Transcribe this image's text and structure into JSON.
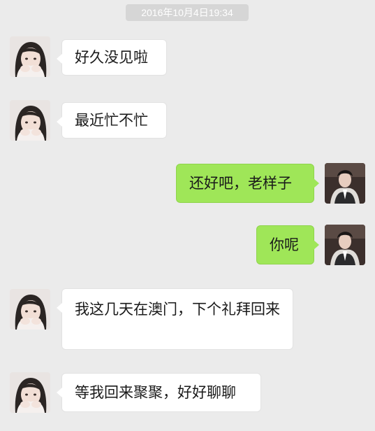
{
  "timestamp": "2016年10月4日19:34",
  "messages": [
    {
      "side": "left",
      "text": "好久没见啦",
      "avatar_icon": "girl-avatar-icon"
    },
    {
      "side": "left",
      "text": "最近忙不忙",
      "avatar_icon": "girl-avatar-icon"
    },
    {
      "side": "right",
      "text": "还好吧，老样子",
      "avatar_icon": "man-avatar-icon"
    },
    {
      "side": "right",
      "text": "你呢",
      "avatar_icon": "man-avatar-icon"
    },
    {
      "side": "left",
      "text": "我这几天在澳门，下个礼拜回来",
      "avatar_icon": "girl-avatar-icon"
    },
    {
      "side": "left",
      "text": "等我回来聚聚，好好聊聊",
      "avatar_icon": "girl-avatar-icon"
    }
  ],
  "colors": {
    "background": "#ebebeb",
    "incoming_bubble": "#ffffff",
    "outgoing_bubble": "#9fe658",
    "timestamp_bg": "#d6d6d6"
  }
}
